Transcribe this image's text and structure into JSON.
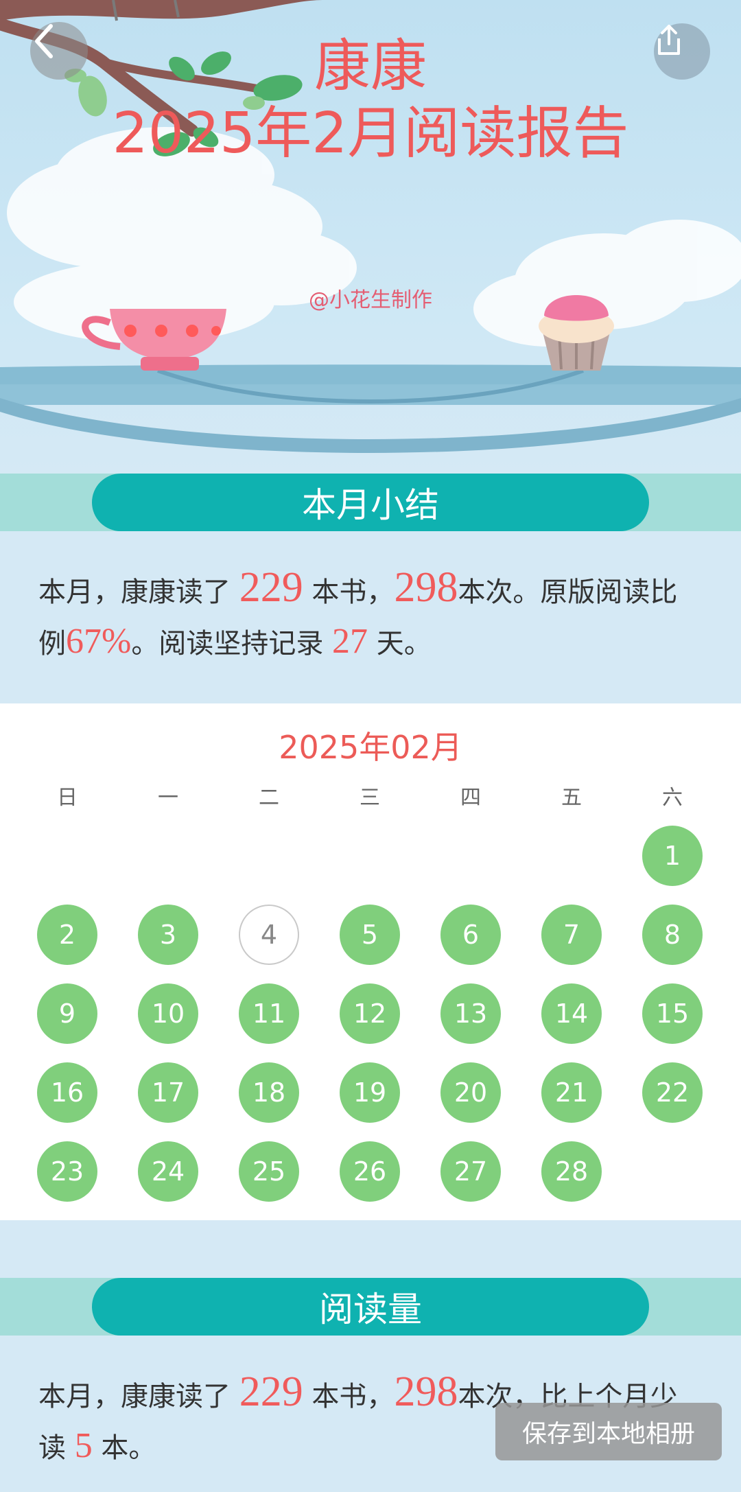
{
  "header": {
    "title_line1": "康康",
    "title_line2": "2025年2月阅读报告",
    "credit": "@小花生制作",
    "back_icon": "chevron-left-icon",
    "share_icon": "share-icon"
  },
  "summary_section": {
    "heading": "本月小结",
    "t1": "本月，康康读了 ",
    "books": "229",
    "t2": " 本书，",
    "times": "298",
    "t3": "本次。原版阅读比例",
    "original_ratio": "67%",
    "t4": "。阅读坚持记录 ",
    "days": "27",
    "t5": " 天。"
  },
  "calendar": {
    "title": "2025年02月",
    "weekdays": [
      "日",
      "一",
      "二",
      "三",
      "四",
      "五",
      "六"
    ],
    "days": [
      "1",
      "2",
      "3",
      "4",
      "5",
      "6",
      "7",
      "8",
      "9",
      "10",
      "11",
      "12",
      "13",
      "14",
      "15",
      "16",
      "17",
      "18",
      "19",
      "20",
      "21",
      "22",
      "23",
      "24",
      "25",
      "26",
      "27",
      "28"
    ],
    "missed_day": "4"
  },
  "volume_section": {
    "heading": "阅读量",
    "t1": "本月，康康读了 ",
    "books": "229",
    "t2": " 本书，",
    "times": "298",
    "t3": "本次，比上个月少读 ",
    "fewer": "5",
    "t4": " 本。"
  },
  "save_button": "保存到本地相册",
  "colors": {
    "accent_red": "#f05b5b",
    "teal": "#0fb2b0",
    "read_day_green": "#80cf7c"
  }
}
